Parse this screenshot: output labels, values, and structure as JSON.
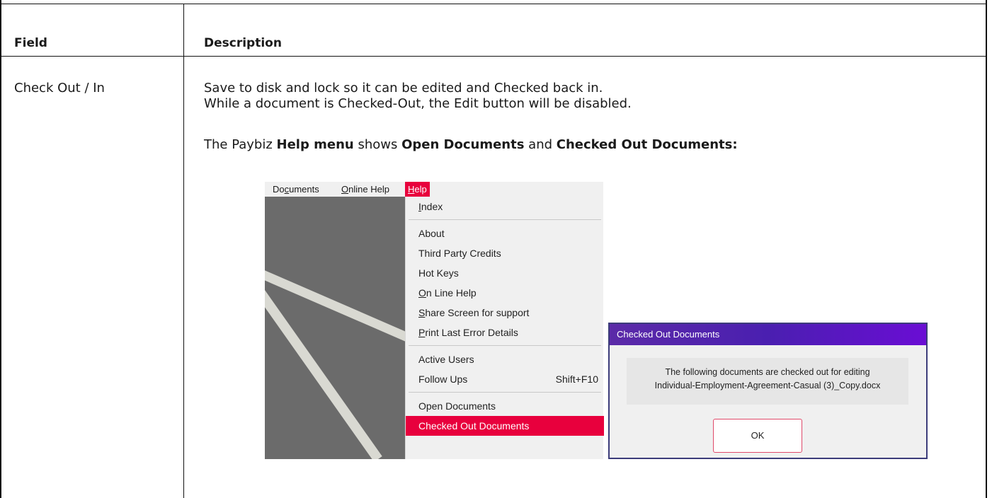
{
  "table": {
    "headers": {
      "field": "Field",
      "description": "Description"
    },
    "row": {
      "field": "Check Out / In",
      "lines": [
        "Save to disk and lock so it can be edited and Checked back in.",
        "While a document is Checked-Out, the Edit button will be disabled."
      ],
      "help_sentence": {
        "p1": "The Paybiz ",
        "b1": "Help menu",
        "p2": " shows ",
        "b2": "Open Documents",
        "p3": " and ",
        "b3": "Checked Out Documents:"
      }
    }
  },
  "menubar": {
    "documents": {
      "pre": "Do",
      "ul": "c",
      "post": "uments"
    },
    "online_help": {
      "ul": "O",
      "post": "nline Help"
    },
    "help": {
      "ul": "H",
      "post": "elp"
    }
  },
  "help_menu": {
    "index": {
      "ul": "I",
      "post": "ndex"
    },
    "about": "About",
    "third_party": "Third Party Credits",
    "hot_keys": "Hot Keys",
    "online_help": {
      "ul": "O",
      "post": "n Line Help"
    },
    "share_screen": {
      "ul": "S",
      "post": "hare Screen for support"
    },
    "print_error": {
      "ul": "P",
      "post": "rint Last Error Details"
    },
    "active_users": "Active Users",
    "follow_ups": {
      "label": "Follow Ups",
      "shortcut": "Shift+F10"
    },
    "open_documents": "Open Documents",
    "checked_out": "Checked Out Documents"
  },
  "dialog": {
    "title": "Checked Out Documents",
    "message_line1": "The following documents are checked out for editing",
    "message_line2": "Individual-Employment-Agreement-Casual (3)_Copy.docx",
    "ok_label": "OK"
  },
  "colors": {
    "menu_highlight": "#e8003d",
    "dialog_title_start": "#5b2aa8",
    "dialog_title_end": "#6a0dd4",
    "ok_border": "#e04a6a"
  }
}
